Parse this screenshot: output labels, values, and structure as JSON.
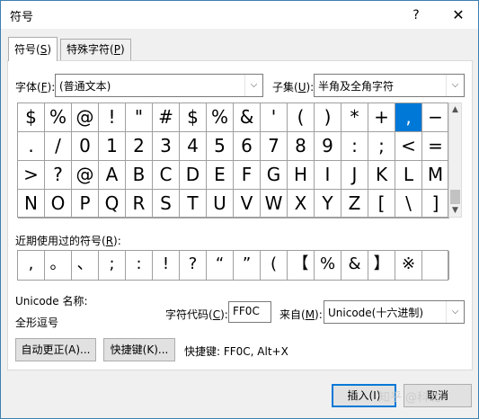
{
  "window": {
    "title": "符号",
    "help": "?",
    "close": "✕"
  },
  "tabs": [
    {
      "label": "符号(",
      "key": "S",
      "suffix": ")",
      "active": true
    },
    {
      "label": "特殊字符(",
      "key": "P",
      "suffix": ")",
      "active": false
    }
  ],
  "font": {
    "label": "字体(",
    "key": "F",
    "suffix": "):",
    "value": "(普通文本)"
  },
  "subset": {
    "label": "子集(",
    "key": "U",
    "suffix": "):",
    "value": "半角及全角字符"
  },
  "grid": {
    "selected_index": 14,
    "symbols": [
      "$",
      "%",
      "@",
      "!",
      "\"",
      "#",
      "$",
      "%",
      "&",
      "'",
      "(",
      ")",
      "*",
      "+",
      ",",
      "−",
      ".",
      "/",
      "0",
      "1",
      "2",
      "3",
      "4",
      "5",
      "6",
      "7",
      "8",
      "9",
      ":",
      ";",
      "<",
      "=",
      ">",
      "?",
      "@",
      "A",
      "B",
      "C",
      "D",
      "E",
      "F",
      "G",
      "H",
      "I",
      "J",
      "K",
      "L",
      "M",
      "N",
      "O",
      "P",
      "Q",
      "R",
      "S",
      "T",
      "U",
      "V",
      "W",
      "X",
      "Y",
      "Z",
      "[",
      "\\",
      "]"
    ]
  },
  "recent": {
    "label": "近期使用过的符号(",
    "key": "R",
    "suffix": "):",
    "symbols": [
      ",",
      "。",
      "、",
      ";",
      ":",
      "!",
      "?",
      "“",
      "”",
      "(",
      "【",
      "%",
      "&",
      "】",
      "※",
      ""
    ]
  },
  "unicode_name_label": "Unicode 名称:",
  "unicode_name_value": "全形逗号",
  "char_code": {
    "label": "字符代码(",
    "key": "C",
    "suffix": "):",
    "value": "FF0C"
  },
  "from": {
    "label": "来自(",
    "key": "M",
    "suffix": "):",
    "value": "Unicode(十六进制)"
  },
  "buttons": {
    "autocorrect": "自动更正(A)...",
    "shortcut_key": "快捷键(K)...",
    "insert": "插入(I)",
    "cancel": "取消"
  },
  "shortcut_text": "快捷键: FF0C, Alt+X",
  "watermark": "知乎 @科北"
}
